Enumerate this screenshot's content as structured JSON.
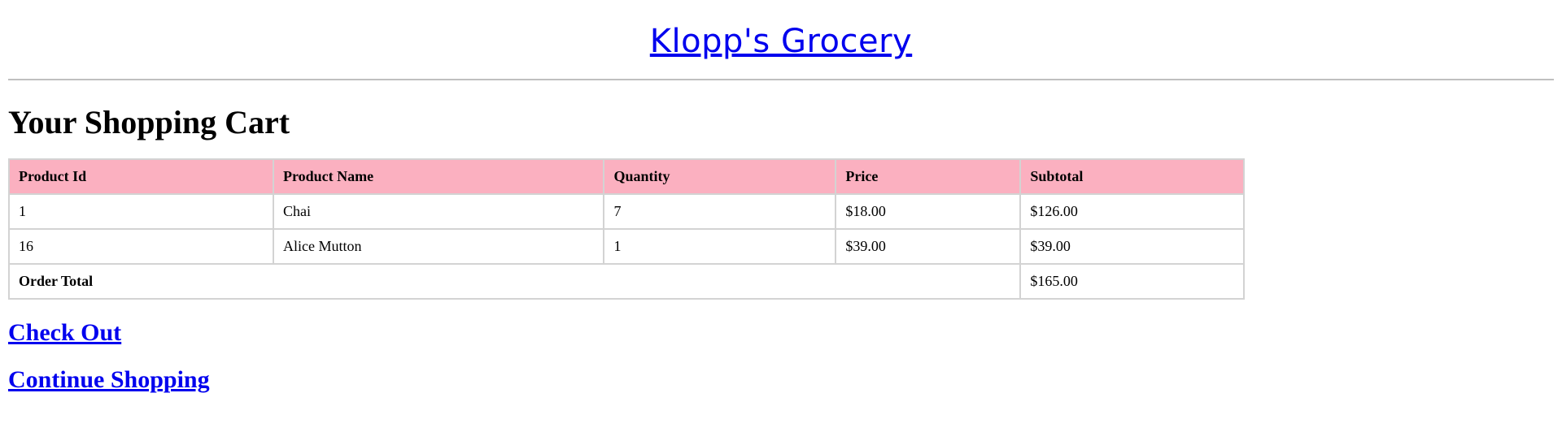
{
  "header": {
    "title": "Klopp's Grocery"
  },
  "page": {
    "title": "Your Shopping Cart"
  },
  "cart": {
    "columns": [
      "Product Id",
      "Product Name",
      "Quantity",
      "Price",
      "Subtotal"
    ],
    "rows": [
      {
        "id": "1",
        "name": "Chai",
        "quantity": "7",
        "price": "$18.00",
        "subtotal": "$126.00"
      },
      {
        "id": "16",
        "name": "Alice Mutton",
        "quantity": "1",
        "price": "$39.00",
        "subtotal": "$39.00"
      }
    ],
    "total_label": "Order Total",
    "total_value": "$165.00"
  },
  "actions": {
    "checkout_label": "Check Out",
    "continue_label": "Continue Shopping"
  },
  "colors": {
    "link": "#0000ee",
    "table_header_bg": "#fbb0c0",
    "border": "#d3d3d3"
  }
}
